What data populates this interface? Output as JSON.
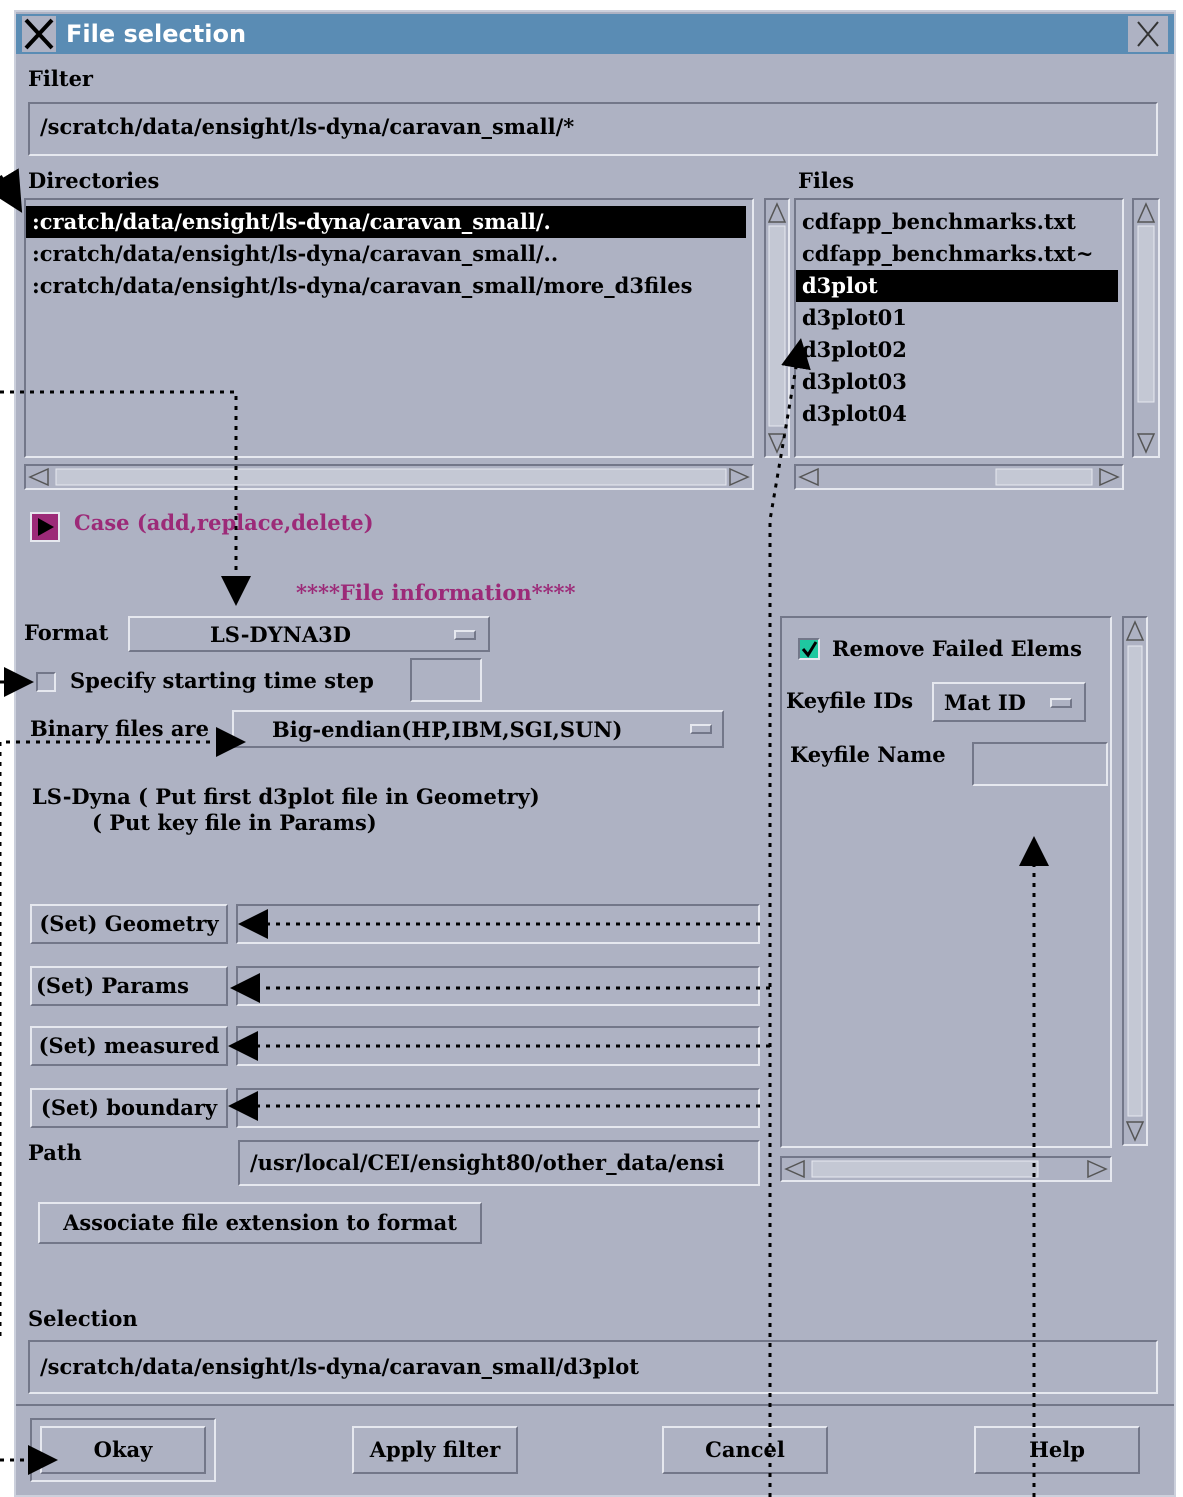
{
  "window": {
    "title": "File selection"
  },
  "filter": {
    "label": "Filter",
    "value": "/scratch/data/ensight/ls-dyna/caravan_small/*"
  },
  "directories": {
    "label": "Directories",
    "items": [
      ":cratch/data/ensight/ls-dyna/caravan_small/.",
      ":cratch/data/ensight/ls-dyna/caravan_small/..",
      ":cratch/data/ensight/ls-dyna/caravan_small/more_d3files"
    ]
  },
  "files": {
    "label": "Files",
    "items": [
      "cdfapp_benchmarks.txt",
      "cdfapp_benchmarks.txt~",
      "d3plot",
      "d3plot01",
      "d3plot02",
      "d3plot03",
      "d3plot04"
    ]
  },
  "case_toggle": {
    "label": "Case (add,replace,delete)"
  },
  "file_info": {
    "heading": "****File information****"
  },
  "format": {
    "label": "Format",
    "value": "LS-DYNA3D"
  },
  "start_time": {
    "label": "Specify starting time step",
    "value": ""
  },
  "binary": {
    "label": "Binary files are",
    "value": "Big-endian(HP,IBM,SGI,SUN)"
  },
  "hint": {
    "line1": "LS-Dyna ( Put first d3plot file in Geometry)",
    "line2": "( Put key file in Params)"
  },
  "set_buttons": {
    "geometry": "(Set) Geometry",
    "params": "(Set) Params",
    "measured": "(Set) measured",
    "boundary": "(Set) boundary"
  },
  "path": {
    "label": "Path",
    "value": "/usr/local/CEI/ensight80/other_data/ensi"
  },
  "associate": {
    "label": "Associate file extension to format"
  },
  "right_panel": {
    "remove_failed": "Remove Failed Elems",
    "keyfile_ids_label": "Keyfile IDs",
    "keyfile_ids_value": "Mat ID",
    "keyfile_name_label": "Keyfile Name",
    "keyfile_name_value": ""
  },
  "selection": {
    "label": "Selection",
    "value": "/scratch/data/ensight/ls-dyna/caravan_small/d3plot"
  },
  "buttons": {
    "okay": "Okay",
    "apply_filter": "Apply filter",
    "cancel": "Cancel",
    "help": "Help"
  },
  "colors": {
    "window_bg": "#aeb2c3",
    "titlebar": "#5a8cb4",
    "accent": "#9c2a78",
    "check": "#1fc8a0"
  }
}
